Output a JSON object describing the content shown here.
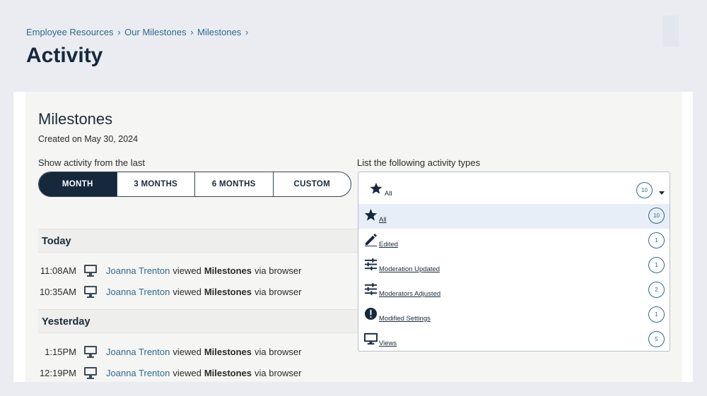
{
  "breadcrumb": {
    "items": [
      "Employee Resources",
      "Our Milestones",
      "Milestones"
    ],
    "separator": "›"
  },
  "page_title": "Activity",
  "milestone": {
    "title": "Milestones",
    "created": "Created on May 30, 2024"
  },
  "range": {
    "label": "Show activity from the last",
    "options": [
      "MONTH",
      "3 MONTHS",
      "6 MONTHS",
      "CUSTOM"
    ],
    "selected": "MONTH"
  },
  "sections": [
    {
      "heading": "Today",
      "entries": [
        {
          "time": "11:08AM",
          "user": "Joanna Trenton",
          "verb": "viewed",
          "item": "Milestones",
          "via": "via browser"
        },
        {
          "time": "10:35AM",
          "user": "Joanna Trenton",
          "verb": "viewed",
          "item": "Milestones",
          "via": "via browser"
        }
      ]
    },
    {
      "heading": "Yesterday",
      "entries": [
        {
          "time": "1:15PM",
          "user": "Joanna Trenton",
          "verb": "viewed",
          "item": "Milestones",
          "via": "via browser"
        },
        {
          "time": "12:19PM",
          "user": "Joanna Trenton",
          "verb": "viewed",
          "item": "Milestones",
          "via": "via browser"
        }
      ]
    }
  ],
  "activity_types": {
    "label": "List the following activity types",
    "selected": {
      "label": "All",
      "count": "10",
      "icon": "star-icon"
    },
    "options": [
      {
        "label": "All",
        "count": "10",
        "icon": "star-icon",
        "highlighted": true
      },
      {
        "label": "Edited",
        "count": "1",
        "icon": "pencil-icon"
      },
      {
        "label": "Moderation Updated",
        "count": "1",
        "icon": "sliders-icon"
      },
      {
        "label": "Moderators Adjusted",
        "count": "2",
        "icon": "sliders-icon"
      },
      {
        "label": "Modified Settings",
        "count": "1",
        "icon": "exclamation-icon"
      },
      {
        "label": "Views",
        "count": "5",
        "icon": "monitor-icon"
      }
    ]
  },
  "colors": {
    "accent": "#15283c",
    "link": "#2f6a8f",
    "page_bg": "#eaecf1"
  }
}
